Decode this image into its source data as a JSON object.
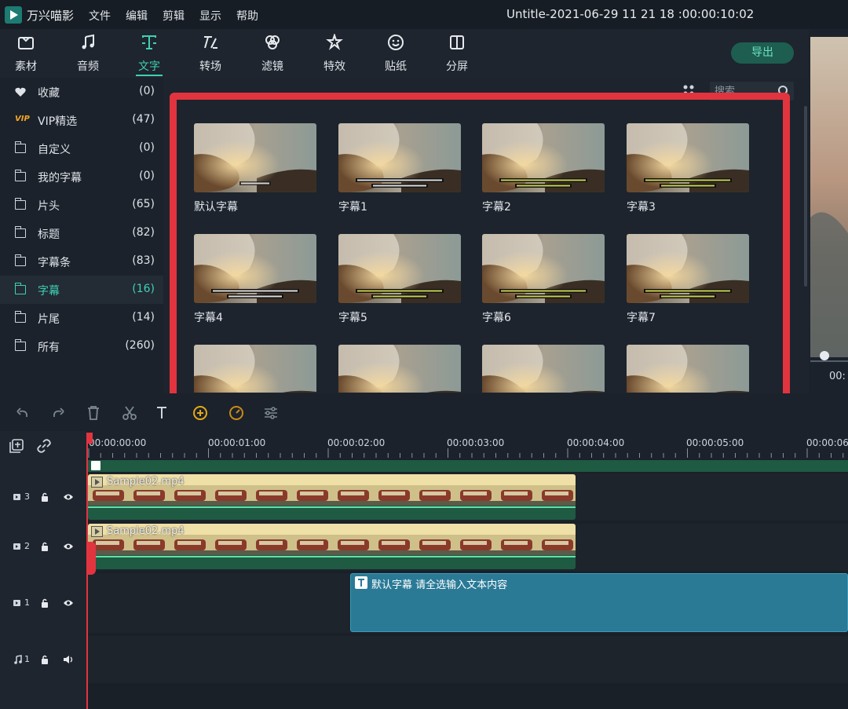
{
  "app": {
    "name": "万兴喵影",
    "document_title": "Untitle-2021-06-29 11 21 18 :00:00:10:02"
  },
  "menu": [
    "文件",
    "编辑",
    "剪辑",
    "显示",
    "帮助"
  ],
  "toolbar": {
    "tabs": [
      {
        "label": "素材",
        "icon": "media-folder-icon"
      },
      {
        "label": "音频",
        "icon": "music-note-icon"
      },
      {
        "label": "文字",
        "icon": "text-icon"
      },
      {
        "label": "转场",
        "icon": "transition-icon"
      },
      {
        "label": "滤镜",
        "icon": "filter-icon"
      },
      {
        "label": "特效",
        "icon": "effects-icon"
      },
      {
        "label": "贴纸",
        "icon": "sticker-icon"
      },
      {
        "label": "分屏",
        "icon": "split-screen-icon"
      }
    ],
    "active_tab": "文字",
    "export_label": "导出"
  },
  "sidebar": {
    "categories": [
      {
        "name": "收藏",
        "count": "(0)",
        "icon": "heart-icon"
      },
      {
        "name": "VIP精选",
        "count": "(47)",
        "icon": "vip-icon",
        "badge": "VIP"
      },
      {
        "name": "自定义",
        "count": "(0)",
        "icon": "folder-icon"
      },
      {
        "name": "我的字幕",
        "count": "(0)",
        "icon": "folder-icon"
      },
      {
        "name": "片头",
        "count": "(65)",
        "icon": "folder-icon"
      },
      {
        "name": "标题",
        "count": "(82)",
        "icon": "folder-icon"
      },
      {
        "name": "字幕条",
        "count": "(83)",
        "icon": "folder-icon"
      },
      {
        "name": "字幕",
        "count": "(16)",
        "icon": "folder-icon",
        "active": true
      },
      {
        "name": "片尾",
        "count": "(14)",
        "icon": "folder-icon"
      },
      {
        "name": "所有",
        "count": "(260)",
        "icon": "folder-icon"
      }
    ]
  },
  "search": {
    "placeholder": "搜索"
  },
  "grid": {
    "items": [
      {
        "label": "默认字幕"
      },
      {
        "label": "字幕1"
      },
      {
        "label": "字幕2"
      },
      {
        "label": "字幕3"
      },
      {
        "label": "字幕4"
      },
      {
        "label": "字幕5"
      },
      {
        "label": "字幕6"
      },
      {
        "label": "字幕7"
      },
      {
        "label": ""
      },
      {
        "label": ""
      },
      {
        "label": ""
      },
      {
        "label": ""
      }
    ]
  },
  "timeline": {
    "ruler_times": [
      "00:00:00:00",
      "00:00:01:00",
      "00:00:02:00",
      "00:00:03:00",
      "00:00:04:00",
      "00:00:05:00",
      "00:00:06:"
    ],
    "tracks": [
      {
        "label": "3",
        "type": "video",
        "clip": "Sample02.mp4"
      },
      {
        "label": "2",
        "type": "video",
        "clip": "Sample02.mp4"
      },
      {
        "label": "1",
        "type": "video",
        "clip": "默认字幕 请全选输入文本内容"
      },
      {
        "label": "1",
        "type": "audio",
        "clip": ""
      }
    ],
    "preview_time": "00:"
  },
  "colors": {
    "accent": "#3fd0b4",
    "highlight": "#e2343f",
    "video_clip": "#1f5a43",
    "title_clip": "#2a7a96"
  }
}
